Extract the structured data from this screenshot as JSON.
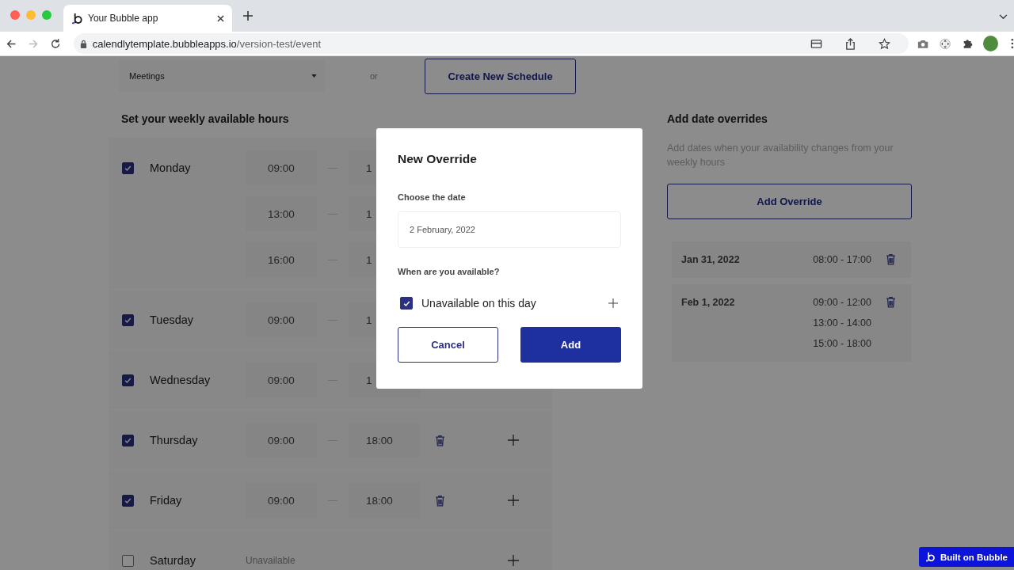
{
  "browser": {
    "tab_title": "Your Bubble app",
    "url_host": "calendlytemplate.bubbleapps.io",
    "url_path": "/version-test/event"
  },
  "schedule_select": {
    "value": "Meetings"
  },
  "or_text": "or",
  "create_button": "Create New Schedule",
  "weekly": {
    "heading": "Set your weekly available hours",
    "days": [
      {
        "name": "Monday",
        "checked": true,
        "slots": [
          {
            "start": "09:00",
            "end": "1"
          },
          {
            "start": "13:00",
            "end": "1"
          },
          {
            "start": "16:00",
            "end": "1"
          }
        ],
        "delete_visible": false,
        "add_visible": false
      },
      {
        "name": "Tuesday",
        "checked": true,
        "slots": [
          {
            "start": "09:00",
            "end": "1"
          }
        ],
        "delete_visible": false,
        "add_visible": false
      },
      {
        "name": "Wednesday",
        "checked": true,
        "slots": [
          {
            "start": "09:00",
            "end": "1"
          }
        ],
        "delete_visible": false,
        "add_visible": false
      },
      {
        "name": "Thursday",
        "checked": true,
        "slots": [
          {
            "start": "09:00",
            "end": "18:00"
          }
        ],
        "delete_visible": true,
        "add_visible": true
      },
      {
        "name": "Friday",
        "checked": true,
        "slots": [
          {
            "start": "09:00",
            "end": "18:00"
          }
        ],
        "delete_visible": true,
        "add_visible": true
      },
      {
        "name": "Saturday",
        "checked": false,
        "unavailable_text": "Unavailable",
        "add_visible": true
      }
    ]
  },
  "overrides": {
    "heading": "Add date overrides",
    "description": "Add dates when your availability changes from your weekly hours",
    "button": "Add Override",
    "entries": [
      {
        "date": "Jan 31, 2022",
        "ranges": [
          "08:00 - 17:00"
        ]
      },
      {
        "date": "Feb 1, 2022",
        "ranges": [
          "09:00 - 12:00",
          "13:00 - 14:00",
          "15:00 - 18:00"
        ]
      }
    ]
  },
  "modal": {
    "title": "New Override",
    "date_label": "Choose the date",
    "date_value": "2 February, 2022",
    "question": "When are you available?",
    "unavailable": {
      "label": "Unavailable on this day",
      "checked": true
    },
    "cancel": "Cancel",
    "add": "Add"
  },
  "badge": "Built on Bubble"
}
